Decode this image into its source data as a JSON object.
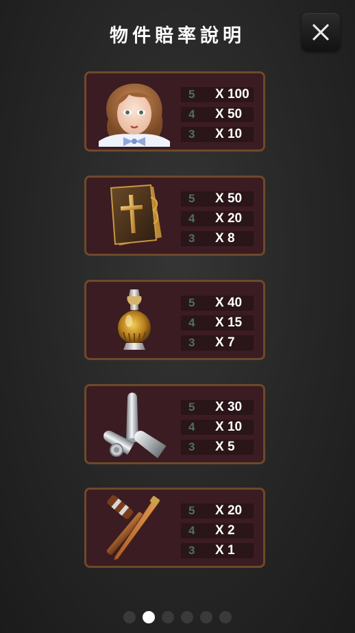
{
  "header": {
    "title": "物件賠率說明",
    "close_icon": "close-icon"
  },
  "paytable": [
    {
      "symbol": "girl",
      "rows": [
        {
          "count": "5",
          "mult": "X 100"
        },
        {
          "count": "4",
          "mult": "X 50"
        },
        {
          "count": "3",
          "mult": "X 10"
        }
      ]
    },
    {
      "symbol": "bible",
      "rows": [
        {
          "count": "5",
          "mult": "X 50"
        },
        {
          "count": "4",
          "mult": "X 20"
        },
        {
          "count": "3",
          "mult": "X 8"
        }
      ]
    },
    {
      "symbol": "potion-bottle",
      "rows": [
        {
          "count": "5",
          "mult": "X 40"
        },
        {
          "count": "4",
          "mult": "X 15"
        },
        {
          "count": "3",
          "mult": "X 7"
        }
      ]
    },
    {
      "symbol": "silver-bullets",
      "rows": [
        {
          "count": "5",
          "mult": "X 30"
        },
        {
          "count": "4",
          "mult": "X 10"
        },
        {
          "count": "3",
          "mult": "X 5"
        }
      ]
    },
    {
      "symbol": "hammer-and-stake",
      "rows": [
        {
          "count": "5",
          "mult": "X 20"
        },
        {
          "count": "4",
          "mult": "X 2"
        },
        {
          "count": "3",
          "mult": "X 1"
        }
      ]
    }
  ],
  "pagination": {
    "pages": 6,
    "current_page": 2
  },
  "colors": {
    "card_bg": "#3b1c22",
    "card_border": "#6e4a2a",
    "count_text": "#4f6f64",
    "mult_text": "#ffffff"
  }
}
